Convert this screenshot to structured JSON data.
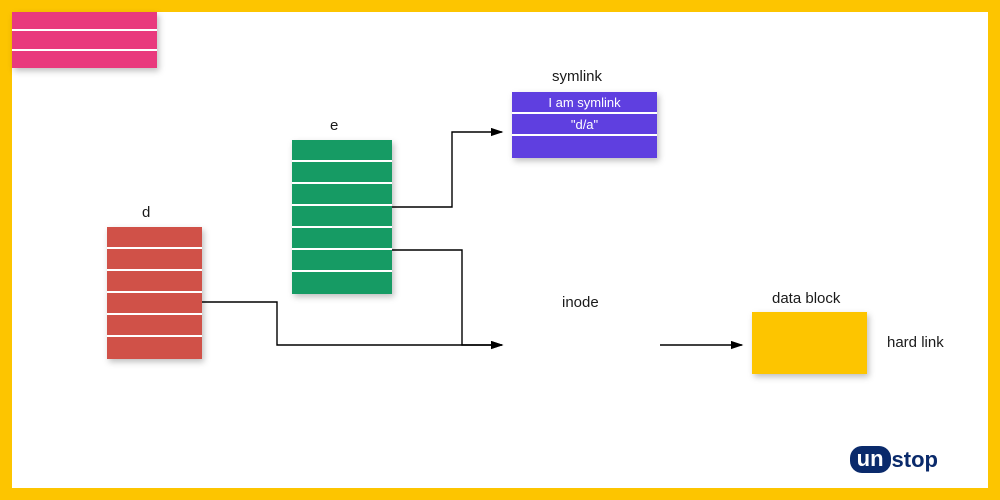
{
  "diagram": {
    "blocks": {
      "d": {
        "label": "d",
        "rows": 6,
        "color": "#d05148"
      },
      "e": {
        "label": "e",
        "rows": 7,
        "color": "#169b64"
      },
      "symlink": {
        "label": "symlink",
        "rows": [
          "I am symlink",
          "\"d/a\"",
          ""
        ],
        "color": "#5f3fe0"
      },
      "inode": {
        "label": "inode",
        "rows": 3,
        "color": "#e93a7d"
      },
      "datablock": {
        "label": "data block",
        "color": "#fdc500"
      }
    },
    "annotations": {
      "hardlink": "hard link"
    },
    "arrows": [
      {
        "from": "d",
        "to": "inode"
      },
      {
        "from": "e",
        "to": "symlink"
      },
      {
        "from": "e",
        "to": "inode"
      },
      {
        "from": "inode",
        "to": "datablock"
      }
    ]
  },
  "branding": {
    "logo_prefix": "un",
    "logo_suffix": "stop"
  }
}
